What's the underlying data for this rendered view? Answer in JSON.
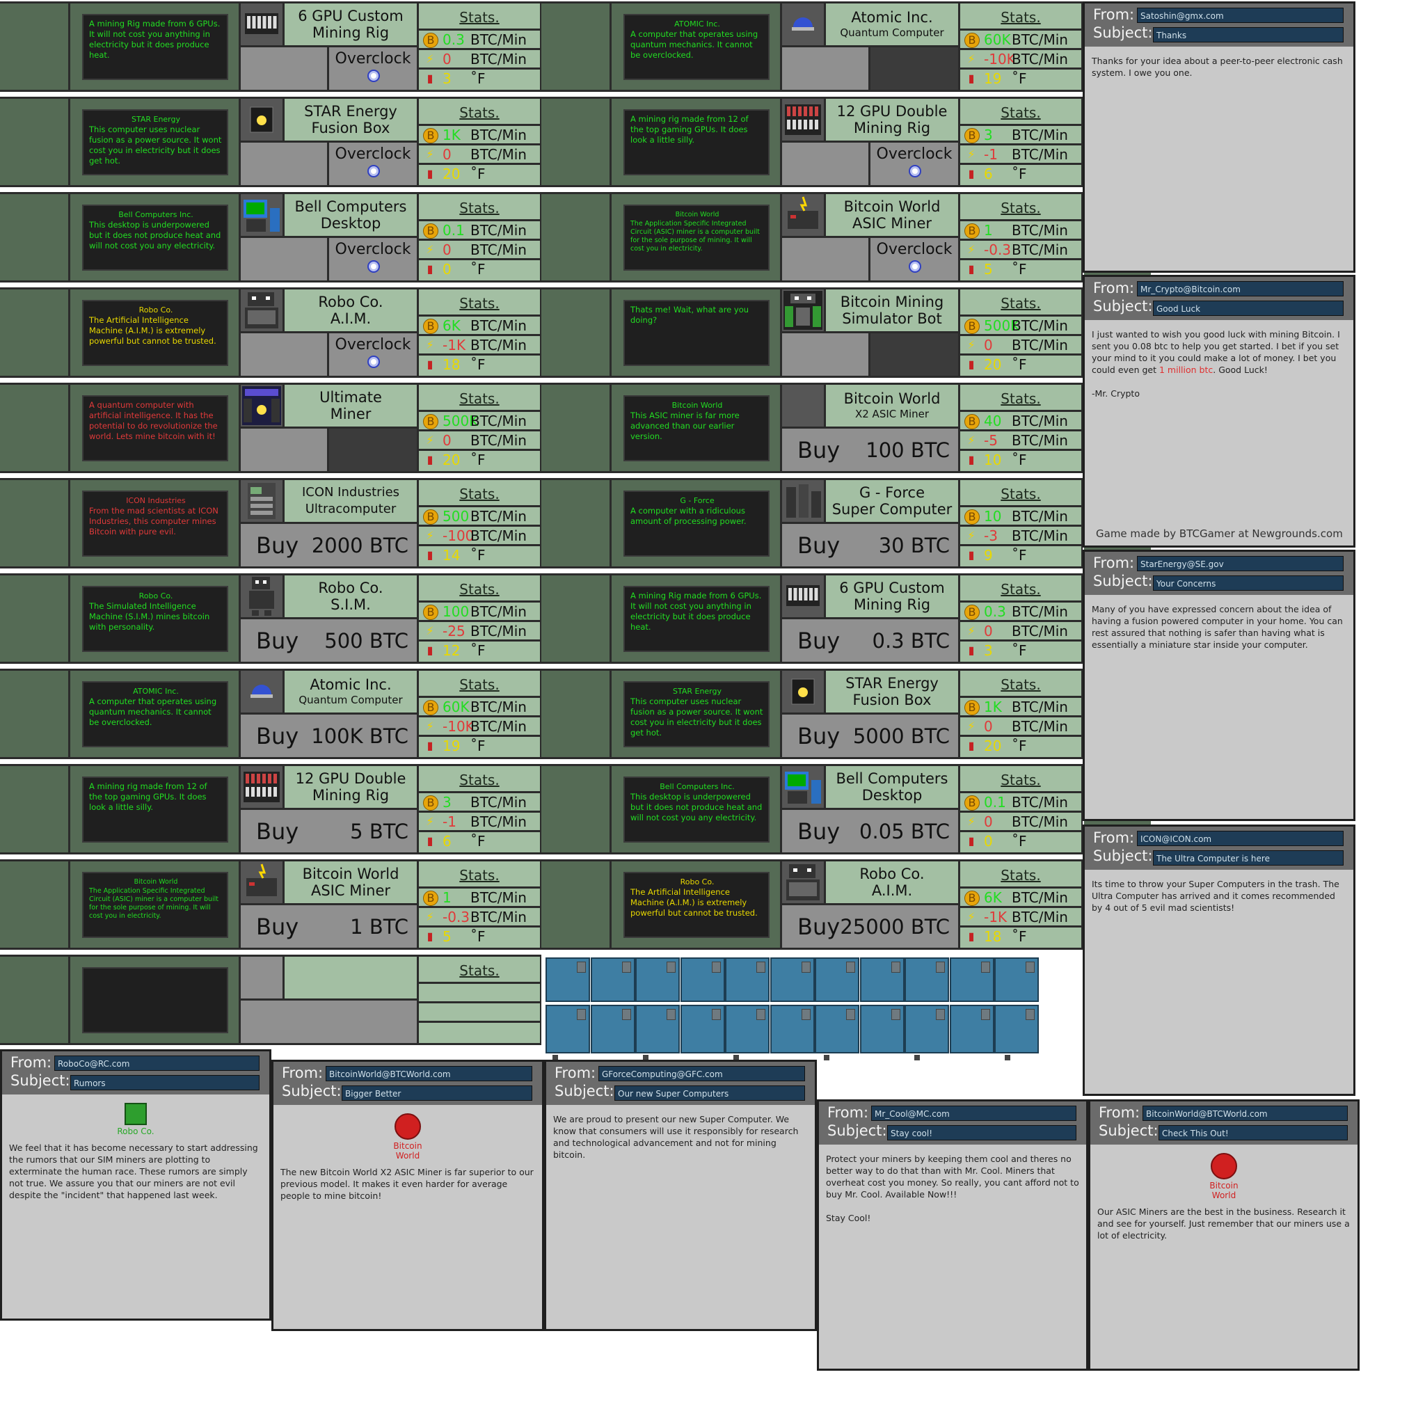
{
  "stats_label": "Stats.",
  "overclock_label": "Overclock",
  "buy_label": "Buy",
  "unit_rate": "BTC/Min",
  "unit_temp": "˚F",
  "icons": {
    "coin": "bitcoin-coin-icon",
    "power": "lightning-icon",
    "heat": "thermometer-icon"
  },
  "left_cards": [
    {
      "id": "6gpu",
      "name": "6 GPU Custom",
      "name2": "Mining Rig",
      "brand": "",
      "desc": "A mining Rig made from 6 GPUs. It will not cost you anything in electricity but it does produce heat.",
      "mode": "overclock",
      "btc": "0.3",
      "pwr": "0",
      "heat": "3",
      "btc_c": "g",
      "pwr_c": "r",
      "heat_c": "y",
      "desc_c": "g"
    },
    {
      "id": "star",
      "name": "STAR Energy",
      "name2": "Fusion Box",
      "brand": "STAR Energy",
      "desc": "This computer uses nuclear fusion as a power source. It wont cost you in electricity but it does get hot.",
      "mode": "overclock",
      "btc": "1K",
      "pwr": "0",
      "heat": "20",
      "btc_c": "g",
      "pwr_c": "r",
      "heat_c": "y",
      "desc_c": "g"
    },
    {
      "id": "bell",
      "name": "Bell Computers",
      "name2": "Desktop",
      "brand": "Bell Computers Inc.",
      "desc": "This desktop is underpowered but it does not produce heat and will not cost you any electricity.",
      "mode": "overclock",
      "btc": "0.1",
      "pwr": "0",
      "heat": "0",
      "btc_c": "g",
      "pwr_c": "r",
      "heat_c": "y",
      "desc_c": "g"
    },
    {
      "id": "aim",
      "name": "Robo Co.",
      "name2": "A.I.M.",
      "brand": "Robo Co.",
      "desc": "The Artificial Intelligence Machine (A.I.M.) is extremely powerful but cannot be trusted.",
      "mode": "overclock",
      "btc": "6K",
      "pwr": "-1K",
      "heat": "18",
      "btc_c": "g",
      "pwr_c": "r",
      "heat_c": "y",
      "desc_c": "y"
    },
    {
      "id": "ultimate",
      "name": "Ultimate",
      "name2": "Miner",
      "brand": "",
      "desc": "A quantum computer with artificial intelligence. It has the potential to do revolutionize the world. Lets mine bitcoin with it!",
      "mode": "dark",
      "btc": "500K",
      "pwr": "0",
      "heat": "20",
      "btc_c": "g",
      "pwr_c": "r",
      "heat_c": "y",
      "desc_c": "r"
    },
    {
      "id": "icon",
      "name": "ICON Industries",
      "name2": "Ultracomputer",
      "brand": "ICON Industries",
      "desc": "From the mad scientists at ICON Industries, this computer mines Bitcoin with pure evil.",
      "mode": "buy",
      "price": "2000 BTC",
      "btc": "500",
      "pwr": "-100",
      "heat": "14",
      "btc_c": "g",
      "pwr_c": "r",
      "heat_c": "y",
      "desc_c": "r",
      "small": true
    },
    {
      "id": "sim",
      "name": "Robo Co.",
      "name2": "S.I.M.",
      "brand": "Robo Co.",
      "desc": "The Simulated Intelligence Machine (S.I.M.) mines bitcoin with personality.",
      "mode": "buy",
      "price": "500 BTC",
      "btc": "100",
      "pwr": "-25",
      "heat": "12",
      "btc_c": "g",
      "pwr_c": "r",
      "heat_c": "y",
      "desc_c": "g"
    },
    {
      "id": "atomic",
      "name": "Atomic Inc.",
      "name2": "Quantum Computer",
      "brand": "ATOMIC Inc.",
      "desc": "A computer that operates using quantum mechanics. It cannot be overclocked.",
      "mode": "buy",
      "price": "100K BTC",
      "btc": "60K",
      "pwr": "-10K",
      "heat": "19",
      "btc_c": "g",
      "pwr_c": "r",
      "heat_c": "y",
      "desc_c": "g",
      "subname": true
    },
    {
      "id": "12gpu",
      "name": "12 GPU Double",
      "name2": "Mining Rig",
      "brand": "",
      "desc": "A mining rig made from 12 of the top gaming GPUs. It does look a little silly.",
      "mode": "buy",
      "price": "5 BTC",
      "btc": "3",
      "pwr": "-1",
      "heat": "6",
      "btc_c": "g",
      "pwr_c": "r",
      "heat_c": "y",
      "desc_c": "g"
    },
    {
      "id": "asic",
      "name": "Bitcoin World",
      "name2": "ASIC Miner",
      "brand": "Bitcoin World",
      "desc": "The Application Specific Integrated Circuit (ASIC) miner is a computer built for the sole purpose of mining. It will cost you in electricity.",
      "mode": "buy",
      "price": "1 BTC",
      "btc": "1",
      "pwr": "-0.3",
      "heat": "5",
      "btc_c": "g",
      "pwr_c": "r",
      "heat_c": "y",
      "desc_c": "g",
      "tiny": true
    }
  ],
  "right_cards": [
    {
      "id": "atomic2",
      "name": "Atomic Inc.",
      "name2": "Quantum Computer",
      "brand": "ATOMIC Inc.",
      "desc": "A computer that operates using quantum mechanics. It cannot be overclocked.",
      "mode": "dark",
      "btc": "60K",
      "pwr": "-10K",
      "heat": "19",
      "btc_c": "g",
      "pwr_c": "r",
      "heat_c": "y",
      "desc_c": "g",
      "subname": true
    },
    {
      "id": "12gpu2",
      "name": "12 GPU Double",
      "name2": "Mining Rig",
      "brand": "",
      "desc": "A mining rig made from 12 of the top gaming GPUs. It does look a little silly.",
      "mode": "overclock",
      "btc": "3",
      "pwr": "-1",
      "heat": "6",
      "btc_c": "g",
      "pwr_c": "r",
      "heat_c": "y",
      "desc_c": "g"
    },
    {
      "id": "asic2",
      "name": "Bitcoin World",
      "name2": "ASIC Miner",
      "brand": "Bitcoin World",
      "desc": "The Application Specific Integrated Circuit (ASIC) miner is a computer built for the sole purpose of mining. It will cost you in electricity.",
      "mode": "overclock",
      "btc": "1",
      "pwr": "-0.3",
      "heat": "5",
      "btc_c": "g",
      "pwr_c": "r",
      "heat_c": "y",
      "desc_c": "g",
      "tiny": true
    },
    {
      "id": "bot",
      "name": "Bitcoin Mining",
      "name2": "Simulator Bot",
      "brand": "",
      "desc": "Thats me! Wait, what are you doing?",
      "mode": "dark",
      "btc": "500K",
      "pwr": "0",
      "heat": "20",
      "btc_c": "g",
      "pwr_c": "r",
      "heat_c": "y",
      "desc_c": "g"
    },
    {
      "id": "x2",
      "name": "Bitcoin World",
      "name2": "X2 ASIC Miner",
      "brand": "Bitcoin World",
      "desc": "This ASIC miner is far more advanced than our earlier version.",
      "mode": "buy",
      "price": "100 BTC",
      "btc": "40",
      "pwr": "-5",
      "heat": "10",
      "btc_c": "g",
      "pwr_c": "r",
      "heat_c": "y",
      "desc_c": "g",
      "subname": true
    },
    {
      "id": "gforce",
      "name": "G - Force",
      "name2": "Super Computer",
      "brand": "G - Force",
      "desc": "A computer with a ridiculous amount of processing power.",
      "mode": "buy",
      "price": "30 BTC",
      "btc": "10",
      "pwr": "-3",
      "heat": "9",
      "btc_c": "g",
      "pwr_c": "r",
      "heat_c": "y",
      "desc_c": "g"
    },
    {
      "id": "6gpu2",
      "name": "6 GPU Custom",
      "name2": "Mining Rig",
      "brand": "",
      "desc": "A mining Rig made from 6 GPUs. It will not cost you anything in electricity but it does produce heat.",
      "mode": "buy",
      "price": "0.3 BTC",
      "btc": "0.3",
      "pwr": "0",
      "heat": "3",
      "btc_c": "g",
      "pwr_c": "r",
      "heat_c": "y",
      "desc_c": "g"
    },
    {
      "id": "star2",
      "name": "STAR Energy",
      "name2": "Fusion Box",
      "brand": "STAR Energy",
      "desc": "This computer uses nuclear fusion as a power source. It wont cost you in electricity but it does get hot.",
      "mode": "buy",
      "price": "5000 BTC",
      "btc": "1K",
      "pwr": "0",
      "heat": "20",
      "btc_c": "g",
      "pwr_c": "r",
      "heat_c": "y",
      "desc_c": "g"
    },
    {
      "id": "bell2",
      "name": "Bell Computers",
      "name2": "Desktop",
      "brand": "Bell Computers Inc.",
      "desc": "This desktop is underpowered but it does not produce heat and will not cost you any electricity.",
      "mode": "buy",
      "price": "0.05 BTC",
      "btc": "0.1",
      "pwr": "0",
      "heat": "0",
      "btc_c": "g",
      "pwr_c": "r",
      "heat_c": "y",
      "desc_c": "g"
    },
    {
      "id": "aim2",
      "name": "Robo Co.",
      "name2": "A.I.M.",
      "brand": "Robo Co.",
      "desc": "The Artificial Intelligence Machine (A.I.M.) is extremely powerful but cannot be trusted.",
      "mode": "buy",
      "price": "25000 BTC",
      "btc": "6K",
      "pwr": "-1K",
      "heat": "18",
      "btc_c": "g",
      "pwr_c": "r",
      "heat_c": "y",
      "desc_c": "y"
    }
  ],
  "emails": [
    {
      "id": "satoshi",
      "from": "Satoshin@gmx.com",
      "subject": "Thanks",
      "body": "Thanks for your idea about a peer-to-peer electronic cash system. I owe you one."
    },
    {
      "id": "crypto",
      "from": "Mr_Crypto@Bitcoin.com",
      "subject": "Good Luck",
      "body_a": "I just wanted to wish you good luck with mining Bitcoin. I sent you 0.08 btc to help you get started. I bet if you set your mind to it you could make a lot of money. I bet you could even get ",
      "body_red": "1 million btc",
      "body_b": ". Good Luck!",
      "sign": "-Mr. Crypto",
      "footer": "Game made by BTCGamer at Newgrounds.com"
    },
    {
      "id": "star",
      "from": "StarEnergy@SE.gov",
      "subject": "Your Concerns",
      "body": "Many of you have expressed concern about the idea of having a fusion powered computer in your home. You can rest assured that nothing is safer than having what is essentially a miniature star inside your computer."
    },
    {
      "id": "icon",
      "from": "ICON@ICON.com",
      "subject": "The Ultra Computer is here",
      "body": "Its time to throw your Super Computers in the trash. The Ultra Computer has arrived and it comes recommended by 4 out of 5 evil mad scientists!"
    },
    {
      "id": "roboco",
      "from": "RoboCo@RC.com",
      "subject": "Rumors",
      "logo": "Robo Co.",
      "body": "We feel that it has become necessary to start addressing the rumors that our SIM miners are plotting to exterminate the human race. These rumors are simply not true. We assure you that our miners are not evil despite the \"incident\" that happened last week."
    },
    {
      "id": "bw1",
      "from": "BitcoinWorld@BTCWorld.com",
      "subject": "Bigger Better",
      "logo": "Bitcoin World",
      "body": "The new Bitcoin World X2 ASIC Miner is far superior to our previous model. It makes it even harder for average people to mine bitcoin!"
    },
    {
      "id": "gforce",
      "from": "GForceComputing@GFC.com",
      "subject": "Our new Super Computers",
      "body": "We are proud to present our new Super Computer. We know that consumers will use it responsibly for research and technological advancement and not for mining bitcoin."
    },
    {
      "id": "cool",
      "from": "Mr_Cool@MC.com",
      "subject": "Stay cool!",
      "body": "Protect your miners by keeping them cool and theres no better way to do that than with Mr. Cool. Miners that overheat cost you money. So really, you cant afford not to buy Mr. Cool. Available Now!!!",
      "sign": "Stay Cool!"
    },
    {
      "id": "bw2",
      "from": "BitcoinWorld@BTCWorld.com",
      "subject": "Check This Out!",
      "logo": "Bitcoin World",
      "body": "Our ASIC Miners are the best in the business. Research it and see for yourself. Just remember that our miners use a lot of electricity."
    }
  ],
  "email_labels": {
    "from": "From:",
    "subject": "Subject:"
  },
  "colors": {
    "panel": "#556b55",
    "light": "#a3bfa3",
    "green": "#22dd22",
    "yellow": "#e8d800",
    "red": "#e03a3a",
    "rack": "#3e7ea3"
  }
}
